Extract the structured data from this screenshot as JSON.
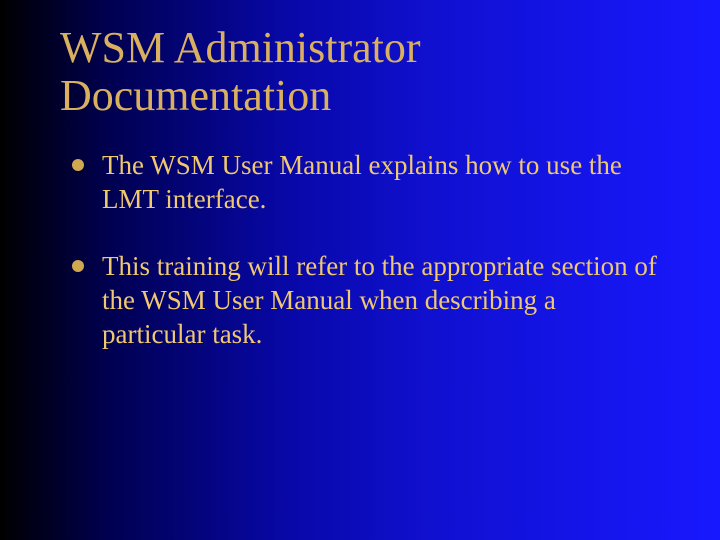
{
  "title": "WSM Administrator Documentation",
  "bullets": [
    "The WSM User Manual explains how to use the LMT interface.",
    "This training will refer to the appropriate section of the WSM User Manual when describing a particular task."
  ]
}
